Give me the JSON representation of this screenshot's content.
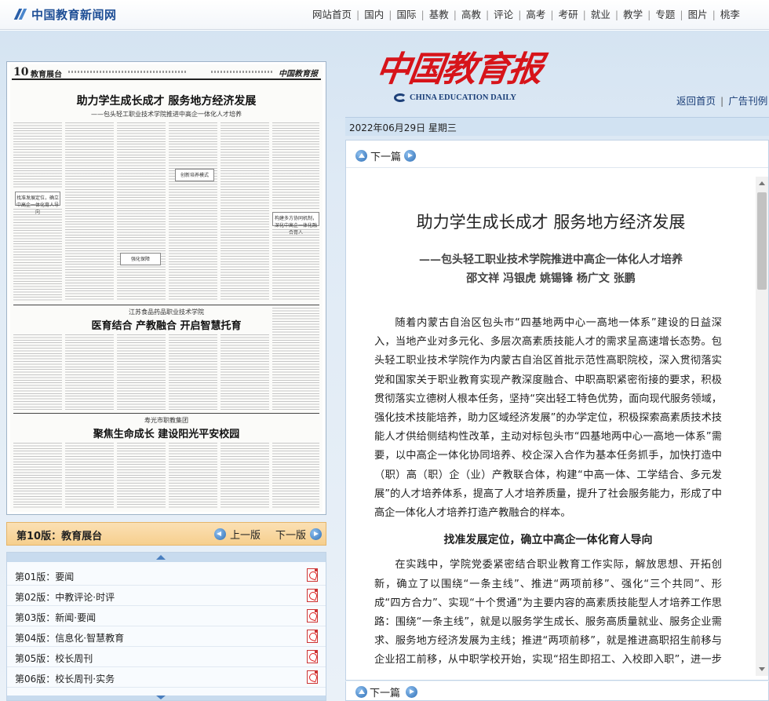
{
  "site": {
    "logo_text": "中国教育新闻网",
    "nav": [
      "网站首页",
      "国内",
      "国际",
      "基教",
      "高教",
      "评论",
      "高考",
      "考研",
      "就业",
      "教学",
      "专题",
      "图片",
      "桃李"
    ]
  },
  "masthead": {
    "title_cn": "中国教育报",
    "title_en": "CHINA EDUCATION DAILY",
    "links": [
      "返回首页",
      "广告刊例"
    ]
  },
  "date_line": "2022年06月29日 星期三",
  "newspaper": {
    "page_no": "10",
    "page_name": "教育展台",
    "logo": "中国教育报",
    "headline1": "助力学生成长成才  服务地方经济发展",
    "sub1": "——包头轻工职业技术学院推进中高企一体化人才培养",
    "kicker2": "江苏食品药品职业技术学院",
    "headline2": "医育结合  产教融合  开启智慧托育",
    "kicker3": "寿光市职教集团",
    "headline3": "聚焦生命成长  建设阳光平安校园",
    "boxes": [
      "找准发展定位，确立中高企一体化育人导向",
      "构建多方协同机制，深化中高企一体化融合育人",
      "创新培养模式",
      "强化保障"
    ]
  },
  "page_bar": {
    "current": "第10版：教育展台",
    "prev": "上一版",
    "next": "下一版"
  },
  "page_list": [
    "第01版：要闻",
    "第02版：中教评论·时评",
    "第03版：新闻·要闻",
    "第04版：信息化·智慧教育",
    "第05版：校长周刊",
    "第06版：校长周刊·实务"
  ],
  "article": {
    "next_label": "下一篇",
    "title": "助力学生成长成才  服务地方经济发展",
    "subtitle": "——包头轻工职业技术学院推进中高企一体化人才培养",
    "authors": "邵文祥  冯银虎  姚锡锋  杨广文  张鹏",
    "para1": "随着内蒙古自治区包头市“四基地两中心一高地一体系”建设的日益深入，当地产业对多元化、多层次高素质技能人才的需求呈高速增长态势。包头轻工职业技术学院作为内蒙古自治区首批示范性高职院校，深入贯彻落实党和国家关于职业教育实现产教深度融合、中职高职紧密衔接的要求，积极贯彻落实立德树人根本任务，坚持“突出轻工特色优势，面向现代服务领域，强化技术技能培养，助力区域经济发展”的办学定位，积极探索高素质技术技能人才供给侧结构性改革，主动对标包头市“四基地两中心一高地一体系”需要，以中高企一体化协同培养、校企深入合作为基本任务抓手，加快打造中（职）高（职）企（业）产教联合体，构建“中高一体、工学结合、多元发展”的人才培养体系，提高了人才培养质量，提升了社会服务能力，形成了中高企一体化人才培养打造产教融合的样本。",
    "heading1": "找准发展定位，确立中高企一体化育人导向",
    "para2": "在实践中，学院党委紧密结合职业教育工作实际，解放思想、开拓创新，确立了以围绕“一条主线”、推进“两项前移”、强化“三个共同”、形成“四方合力”、实现“十个贯通”为主要内容的高素质技能型人才培养工作思路：围绕“一条主线”，就是以服务学生成长、服务高质量就业、服务企业需求、服务地方经济发展为主线；推进“两项前移”，就是推进高职招生前移与企业招工前移，从中职学校开始，实现“招生即招工、入校即入职”，进一步推进“学生的归属感、学校的成就感、家长的认同度、企业的满意度”四者无障碍契合，着力破解学校“招生难”和企业“用工荒”的现实问题。强化“三个共同”，就是共同招生、共同培养、共同就业。"
  },
  "bottom_nav": {
    "next_label": "下一篇"
  }
}
